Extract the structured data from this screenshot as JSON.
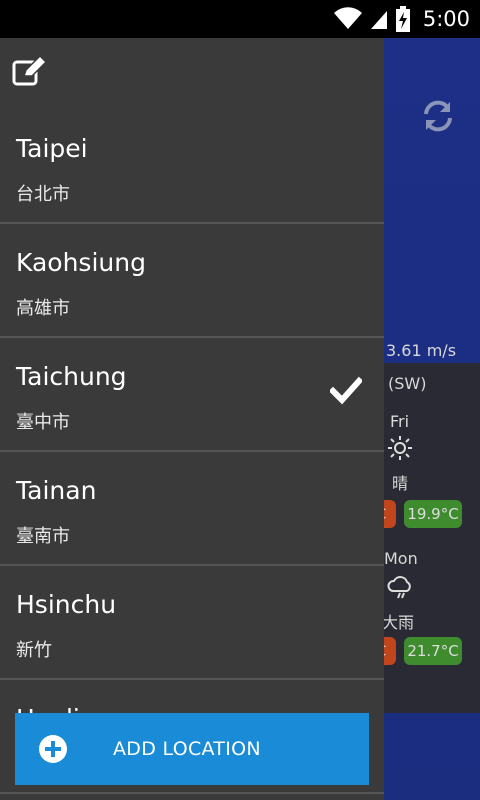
{
  "status_bar": {
    "time": "5:00",
    "icons": [
      "wifi-icon",
      "signal-icon",
      "battery-charging-icon"
    ]
  },
  "background": {
    "wind_speed": "3.61 m/s",
    "wind_dir": "(SW)",
    "forecast": [
      {
        "day": "Fri",
        "icon": "sun-icon",
        "desc": "晴",
        "low_partial": "C",
        "temp": "19.9°C"
      },
      {
        "day": "Mon",
        "icon": "rain-cloud-icon",
        "desc": "大雨",
        "low_partial": "C",
        "temp": "21.7°C"
      }
    ],
    "colors": {
      "red": "#c1461b",
      "green": "#3f8c2f"
    }
  },
  "drawer": {
    "locations": [
      {
        "name": "Taipei",
        "sub": "台北市",
        "selected": false
      },
      {
        "name": "Kaohsiung",
        "sub": "高雄市",
        "selected": false
      },
      {
        "name": "Taichung",
        "sub": "臺中市",
        "selected": true
      },
      {
        "name": "Tainan",
        "sub": "臺南市",
        "selected": false
      },
      {
        "name": "Hsinchu",
        "sub": "新竹",
        "selected": false
      },
      {
        "name": "Hualien",
        "sub": "",
        "selected": false
      }
    ],
    "add_location_label": "ADD LOCATION",
    "accent": "#1a8bd6"
  }
}
